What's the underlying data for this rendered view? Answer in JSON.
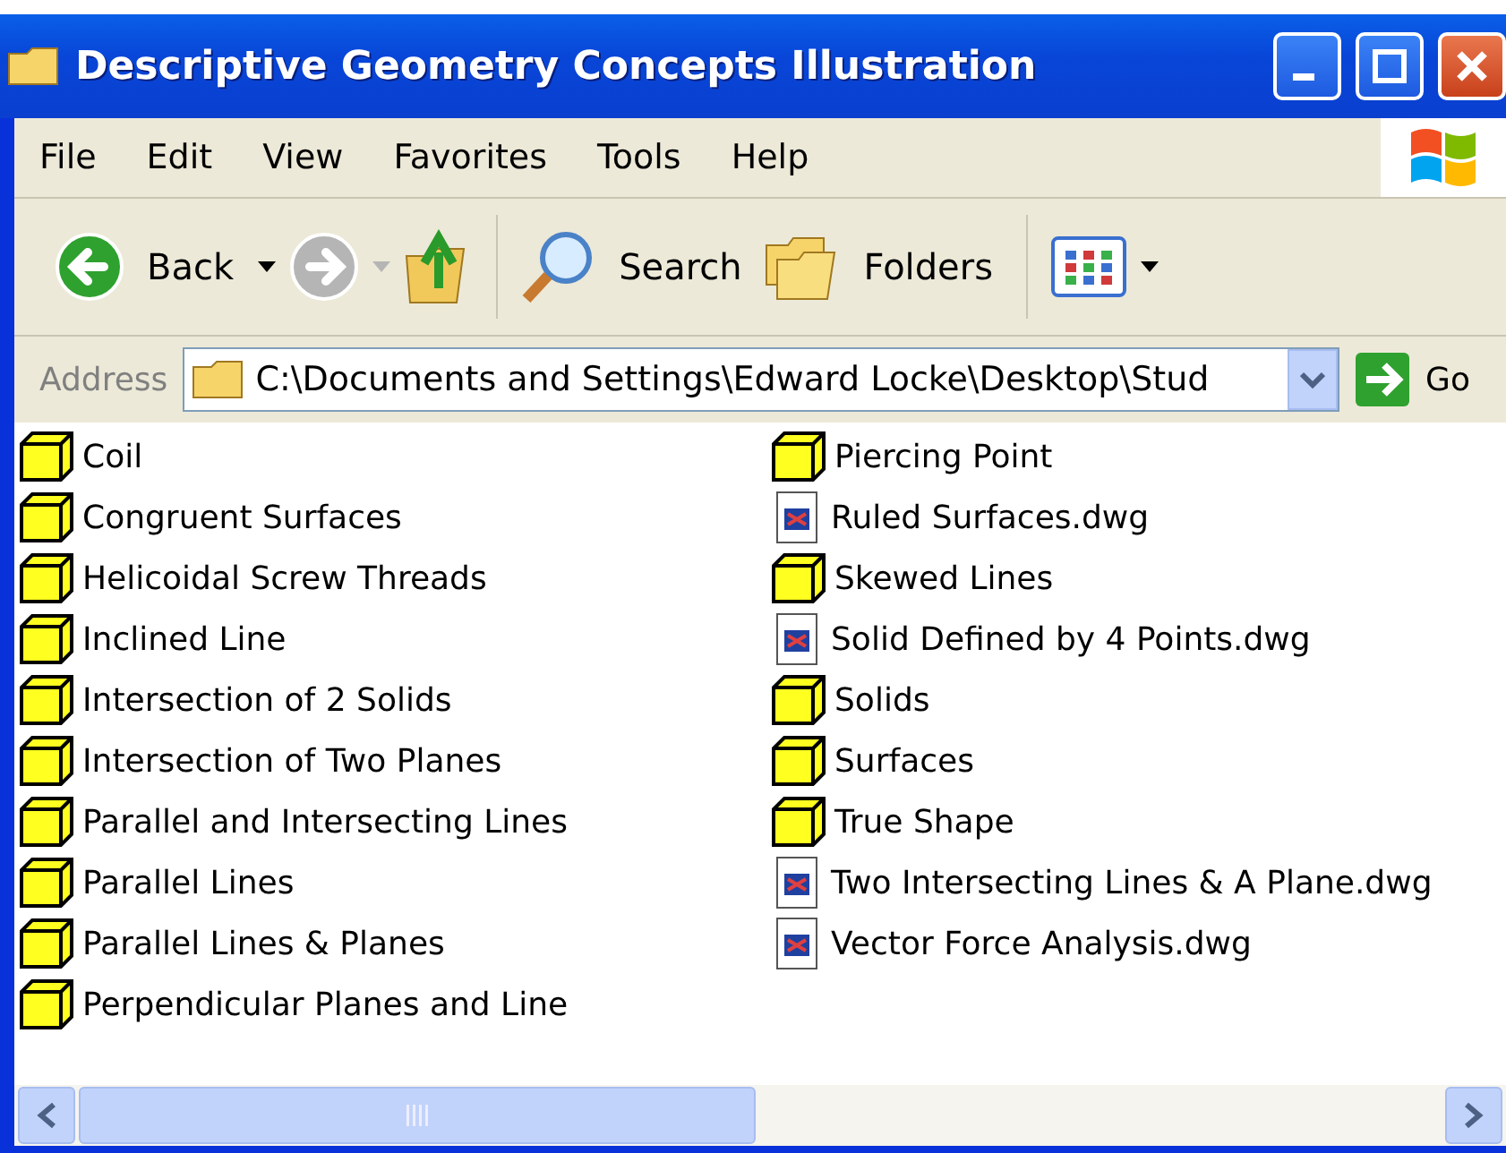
{
  "window": {
    "title": "Descriptive Geometry Concepts Illustration"
  },
  "menu": [
    "File",
    "Edit",
    "View",
    "Favorites",
    "Tools",
    "Help"
  ],
  "toolbar": {
    "back": "Back",
    "search": "Search",
    "folders": "Folders"
  },
  "address": {
    "label": "Address",
    "value": "C:\\Documents and Settings\\Edward Locke\\Desktop\\Stud",
    "go": "Go"
  },
  "files": [
    {
      "name": "Coil",
      "kind": "block"
    },
    {
      "name": "Congruent Surfaces",
      "kind": "block"
    },
    {
      "name": "Helicoidal Screw Threads",
      "kind": "block"
    },
    {
      "name": "Inclined Line",
      "kind": "block"
    },
    {
      "name": "Intersection of 2 Solids",
      "kind": "block"
    },
    {
      "name": "Intersection of Two Planes",
      "kind": "block"
    },
    {
      "name": "Parallel and Intersecting Lines",
      "kind": "block"
    },
    {
      "name": "Parallel Lines",
      "kind": "block"
    },
    {
      "name": "Parallel Lines & Planes",
      "kind": "block"
    },
    {
      "name": "Perpendicular Planes and Line",
      "kind": "block"
    },
    {
      "name": "Piercing Point",
      "kind": "block"
    },
    {
      "name": "Ruled Surfaces.dwg",
      "kind": "dwg"
    },
    {
      "name": "Skewed Lines",
      "kind": "block"
    },
    {
      "name": "Solid Defined by 4 Points.dwg",
      "kind": "dwg"
    },
    {
      "name": "Solids",
      "kind": "block"
    },
    {
      "name": "Surfaces",
      "kind": "block"
    },
    {
      "name": "True Shape",
      "kind": "block"
    },
    {
      "name": "Two Intersecting Lines & A Plane.dwg",
      "kind": "dwg"
    },
    {
      "name": "Vector Force Analysis.dwg",
      "kind": "dwg"
    }
  ]
}
